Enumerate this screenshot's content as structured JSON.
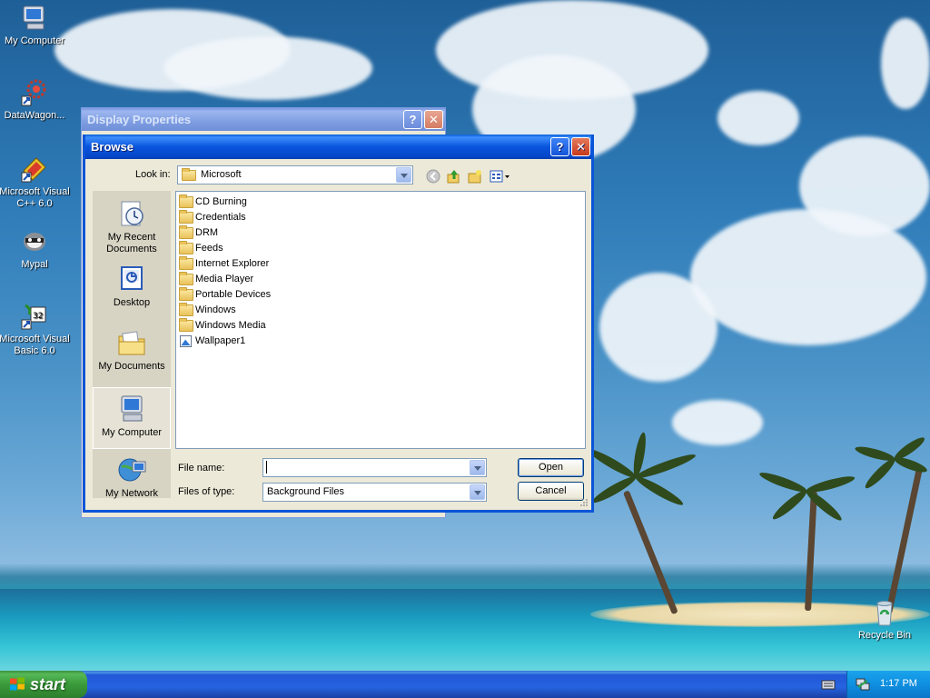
{
  "desktop": {
    "icons": [
      {
        "label": "My Computer"
      },
      {
        "label": "DataWagon..."
      },
      {
        "label": "Microsoft Visual C++ 6.0"
      },
      {
        "label": "Mypal"
      },
      {
        "label": "Microsoft Visual Basic 6.0"
      },
      {
        "label": "Recycle Bin"
      }
    ]
  },
  "display_properties": {
    "title": "Display Properties",
    "help_glyph": "?",
    "close_glyph": "✕"
  },
  "browse": {
    "title": "Browse",
    "help_glyph": "?",
    "close_glyph": "✕",
    "look_in_label": "Look in:",
    "look_in_value": "Microsoft",
    "places": [
      {
        "label": "My Recent Documents",
        "icon": "recent-documents-icon"
      },
      {
        "label": "Desktop",
        "icon": "desktop-icon"
      },
      {
        "label": "My Documents",
        "icon": "my-documents-icon"
      },
      {
        "label": "My Computer",
        "icon": "my-computer-icon"
      },
      {
        "label": "My Network",
        "icon": "my-network-icon"
      }
    ],
    "files": [
      {
        "name": "CD Burning",
        "kind": "folder"
      },
      {
        "name": "Credentials",
        "kind": "folder"
      },
      {
        "name": "DRM",
        "kind": "folder"
      },
      {
        "name": "Feeds",
        "kind": "folder"
      },
      {
        "name": "Internet Explorer",
        "kind": "folder"
      },
      {
        "name": "Media Player",
        "kind": "folder"
      },
      {
        "name": "Portable Devices",
        "kind": "folder"
      },
      {
        "name": "Windows",
        "kind": "folder"
      },
      {
        "name": "Windows Media",
        "kind": "folder"
      },
      {
        "name": "Wallpaper1",
        "kind": "image"
      }
    ],
    "file_name_label": "File name:",
    "file_name_value": "",
    "files_of_type_label": "Files of type:",
    "files_of_type_value": "Background Files",
    "open_label": "Open",
    "cancel_label": "Cancel"
  },
  "taskbar": {
    "start_label": "start",
    "clock": "1:17 PM"
  },
  "colors": {
    "title_active": "#0855dd",
    "title_inactive": "#7e9de2",
    "dialog_face": "#ece9d8",
    "taskbar": "#2663e0",
    "start_green": "#3a9a3a"
  }
}
